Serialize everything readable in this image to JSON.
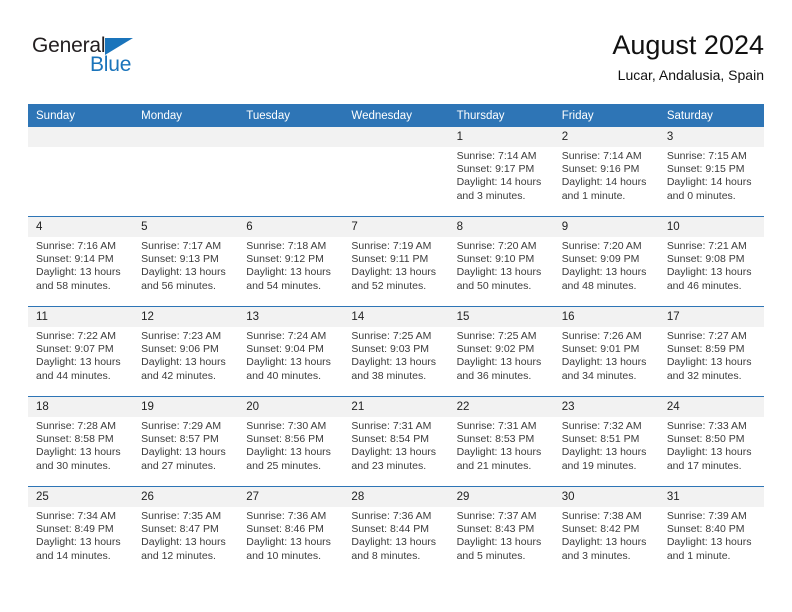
{
  "brand": {
    "line1": "General",
    "line2": "Blue",
    "accent_color": "#1a74bb"
  },
  "header": {
    "title": "August 2024",
    "subtitle": "Lucar, Andalusia, Spain"
  },
  "theme": {
    "header_row_bg": "#2e75b6",
    "daynum_bg": "#f2f2f2",
    "text_color": "#3b3b3b"
  },
  "labels": {
    "sunrise_prefix": "Sunrise:",
    "sunset_prefix": "Sunset:",
    "daylight_prefix": "Daylight:"
  },
  "weekdays": [
    "Sunday",
    "Monday",
    "Tuesday",
    "Wednesday",
    "Thursday",
    "Friday",
    "Saturday"
  ],
  "weeks": [
    [
      {
        "day": "",
        "empty": true
      },
      {
        "day": "",
        "empty": true
      },
      {
        "day": "",
        "empty": true
      },
      {
        "day": "",
        "empty": true
      },
      {
        "day": "1",
        "sunrise": "Sunrise: 7:14 AM",
        "sunset": "Sunset: 9:17 PM",
        "daylight_l1": "Daylight: 14 hours",
        "daylight_l2": "and 3 minutes."
      },
      {
        "day": "2",
        "sunrise": "Sunrise: 7:14 AM",
        "sunset": "Sunset: 9:16 PM",
        "daylight_l1": "Daylight: 14 hours",
        "daylight_l2": "and 1 minute."
      },
      {
        "day": "3",
        "sunrise": "Sunrise: 7:15 AM",
        "sunset": "Sunset: 9:15 PM",
        "daylight_l1": "Daylight: 14 hours",
        "daylight_l2": "and 0 minutes."
      }
    ],
    [
      {
        "day": "4",
        "sunrise": "Sunrise: 7:16 AM",
        "sunset": "Sunset: 9:14 PM",
        "daylight_l1": "Daylight: 13 hours",
        "daylight_l2": "and 58 minutes."
      },
      {
        "day": "5",
        "sunrise": "Sunrise: 7:17 AM",
        "sunset": "Sunset: 9:13 PM",
        "daylight_l1": "Daylight: 13 hours",
        "daylight_l2": "and 56 minutes."
      },
      {
        "day": "6",
        "sunrise": "Sunrise: 7:18 AM",
        "sunset": "Sunset: 9:12 PM",
        "daylight_l1": "Daylight: 13 hours",
        "daylight_l2": "and 54 minutes."
      },
      {
        "day": "7",
        "sunrise": "Sunrise: 7:19 AM",
        "sunset": "Sunset: 9:11 PM",
        "daylight_l1": "Daylight: 13 hours",
        "daylight_l2": "and 52 minutes."
      },
      {
        "day": "8",
        "sunrise": "Sunrise: 7:20 AM",
        "sunset": "Sunset: 9:10 PM",
        "daylight_l1": "Daylight: 13 hours",
        "daylight_l2": "and 50 minutes."
      },
      {
        "day": "9",
        "sunrise": "Sunrise: 7:20 AM",
        "sunset": "Sunset: 9:09 PM",
        "daylight_l1": "Daylight: 13 hours",
        "daylight_l2": "and 48 minutes."
      },
      {
        "day": "10",
        "sunrise": "Sunrise: 7:21 AM",
        "sunset": "Sunset: 9:08 PM",
        "daylight_l1": "Daylight: 13 hours",
        "daylight_l2": "and 46 minutes."
      }
    ],
    [
      {
        "day": "11",
        "sunrise": "Sunrise: 7:22 AM",
        "sunset": "Sunset: 9:07 PM",
        "daylight_l1": "Daylight: 13 hours",
        "daylight_l2": "and 44 minutes."
      },
      {
        "day": "12",
        "sunrise": "Sunrise: 7:23 AM",
        "sunset": "Sunset: 9:06 PM",
        "daylight_l1": "Daylight: 13 hours",
        "daylight_l2": "and 42 minutes."
      },
      {
        "day": "13",
        "sunrise": "Sunrise: 7:24 AM",
        "sunset": "Sunset: 9:04 PM",
        "daylight_l1": "Daylight: 13 hours",
        "daylight_l2": "and 40 minutes."
      },
      {
        "day": "14",
        "sunrise": "Sunrise: 7:25 AM",
        "sunset": "Sunset: 9:03 PM",
        "daylight_l1": "Daylight: 13 hours",
        "daylight_l2": "and 38 minutes."
      },
      {
        "day": "15",
        "sunrise": "Sunrise: 7:25 AM",
        "sunset": "Sunset: 9:02 PM",
        "daylight_l1": "Daylight: 13 hours",
        "daylight_l2": "and 36 minutes."
      },
      {
        "day": "16",
        "sunrise": "Sunrise: 7:26 AM",
        "sunset": "Sunset: 9:01 PM",
        "daylight_l1": "Daylight: 13 hours",
        "daylight_l2": "and 34 minutes."
      },
      {
        "day": "17",
        "sunrise": "Sunrise: 7:27 AM",
        "sunset": "Sunset: 8:59 PM",
        "daylight_l1": "Daylight: 13 hours",
        "daylight_l2": "and 32 minutes."
      }
    ],
    [
      {
        "day": "18",
        "sunrise": "Sunrise: 7:28 AM",
        "sunset": "Sunset: 8:58 PM",
        "daylight_l1": "Daylight: 13 hours",
        "daylight_l2": "and 30 minutes."
      },
      {
        "day": "19",
        "sunrise": "Sunrise: 7:29 AM",
        "sunset": "Sunset: 8:57 PM",
        "daylight_l1": "Daylight: 13 hours",
        "daylight_l2": "and 27 minutes."
      },
      {
        "day": "20",
        "sunrise": "Sunrise: 7:30 AM",
        "sunset": "Sunset: 8:56 PM",
        "daylight_l1": "Daylight: 13 hours",
        "daylight_l2": "and 25 minutes."
      },
      {
        "day": "21",
        "sunrise": "Sunrise: 7:31 AM",
        "sunset": "Sunset: 8:54 PM",
        "daylight_l1": "Daylight: 13 hours",
        "daylight_l2": "and 23 minutes."
      },
      {
        "day": "22",
        "sunrise": "Sunrise: 7:31 AM",
        "sunset": "Sunset: 8:53 PM",
        "daylight_l1": "Daylight: 13 hours",
        "daylight_l2": "and 21 minutes."
      },
      {
        "day": "23",
        "sunrise": "Sunrise: 7:32 AM",
        "sunset": "Sunset: 8:51 PM",
        "daylight_l1": "Daylight: 13 hours",
        "daylight_l2": "and 19 minutes."
      },
      {
        "day": "24",
        "sunrise": "Sunrise: 7:33 AM",
        "sunset": "Sunset: 8:50 PM",
        "daylight_l1": "Daylight: 13 hours",
        "daylight_l2": "and 17 minutes."
      }
    ],
    [
      {
        "day": "25",
        "sunrise": "Sunrise: 7:34 AM",
        "sunset": "Sunset: 8:49 PM",
        "daylight_l1": "Daylight: 13 hours",
        "daylight_l2": "and 14 minutes."
      },
      {
        "day": "26",
        "sunrise": "Sunrise: 7:35 AM",
        "sunset": "Sunset: 8:47 PM",
        "daylight_l1": "Daylight: 13 hours",
        "daylight_l2": "and 12 minutes."
      },
      {
        "day": "27",
        "sunrise": "Sunrise: 7:36 AM",
        "sunset": "Sunset: 8:46 PM",
        "daylight_l1": "Daylight: 13 hours",
        "daylight_l2": "and 10 minutes."
      },
      {
        "day": "28",
        "sunrise": "Sunrise: 7:36 AM",
        "sunset": "Sunset: 8:44 PM",
        "daylight_l1": "Daylight: 13 hours",
        "daylight_l2": "and 8 minutes."
      },
      {
        "day": "29",
        "sunrise": "Sunrise: 7:37 AM",
        "sunset": "Sunset: 8:43 PM",
        "daylight_l1": "Daylight: 13 hours",
        "daylight_l2": "and 5 minutes."
      },
      {
        "day": "30",
        "sunrise": "Sunrise: 7:38 AM",
        "sunset": "Sunset: 8:42 PM",
        "daylight_l1": "Daylight: 13 hours",
        "daylight_l2": "and 3 minutes."
      },
      {
        "day": "31",
        "sunrise": "Sunrise: 7:39 AM",
        "sunset": "Sunset: 8:40 PM",
        "daylight_l1": "Daylight: 13 hours",
        "daylight_l2": "and 1 minute."
      }
    ]
  ]
}
